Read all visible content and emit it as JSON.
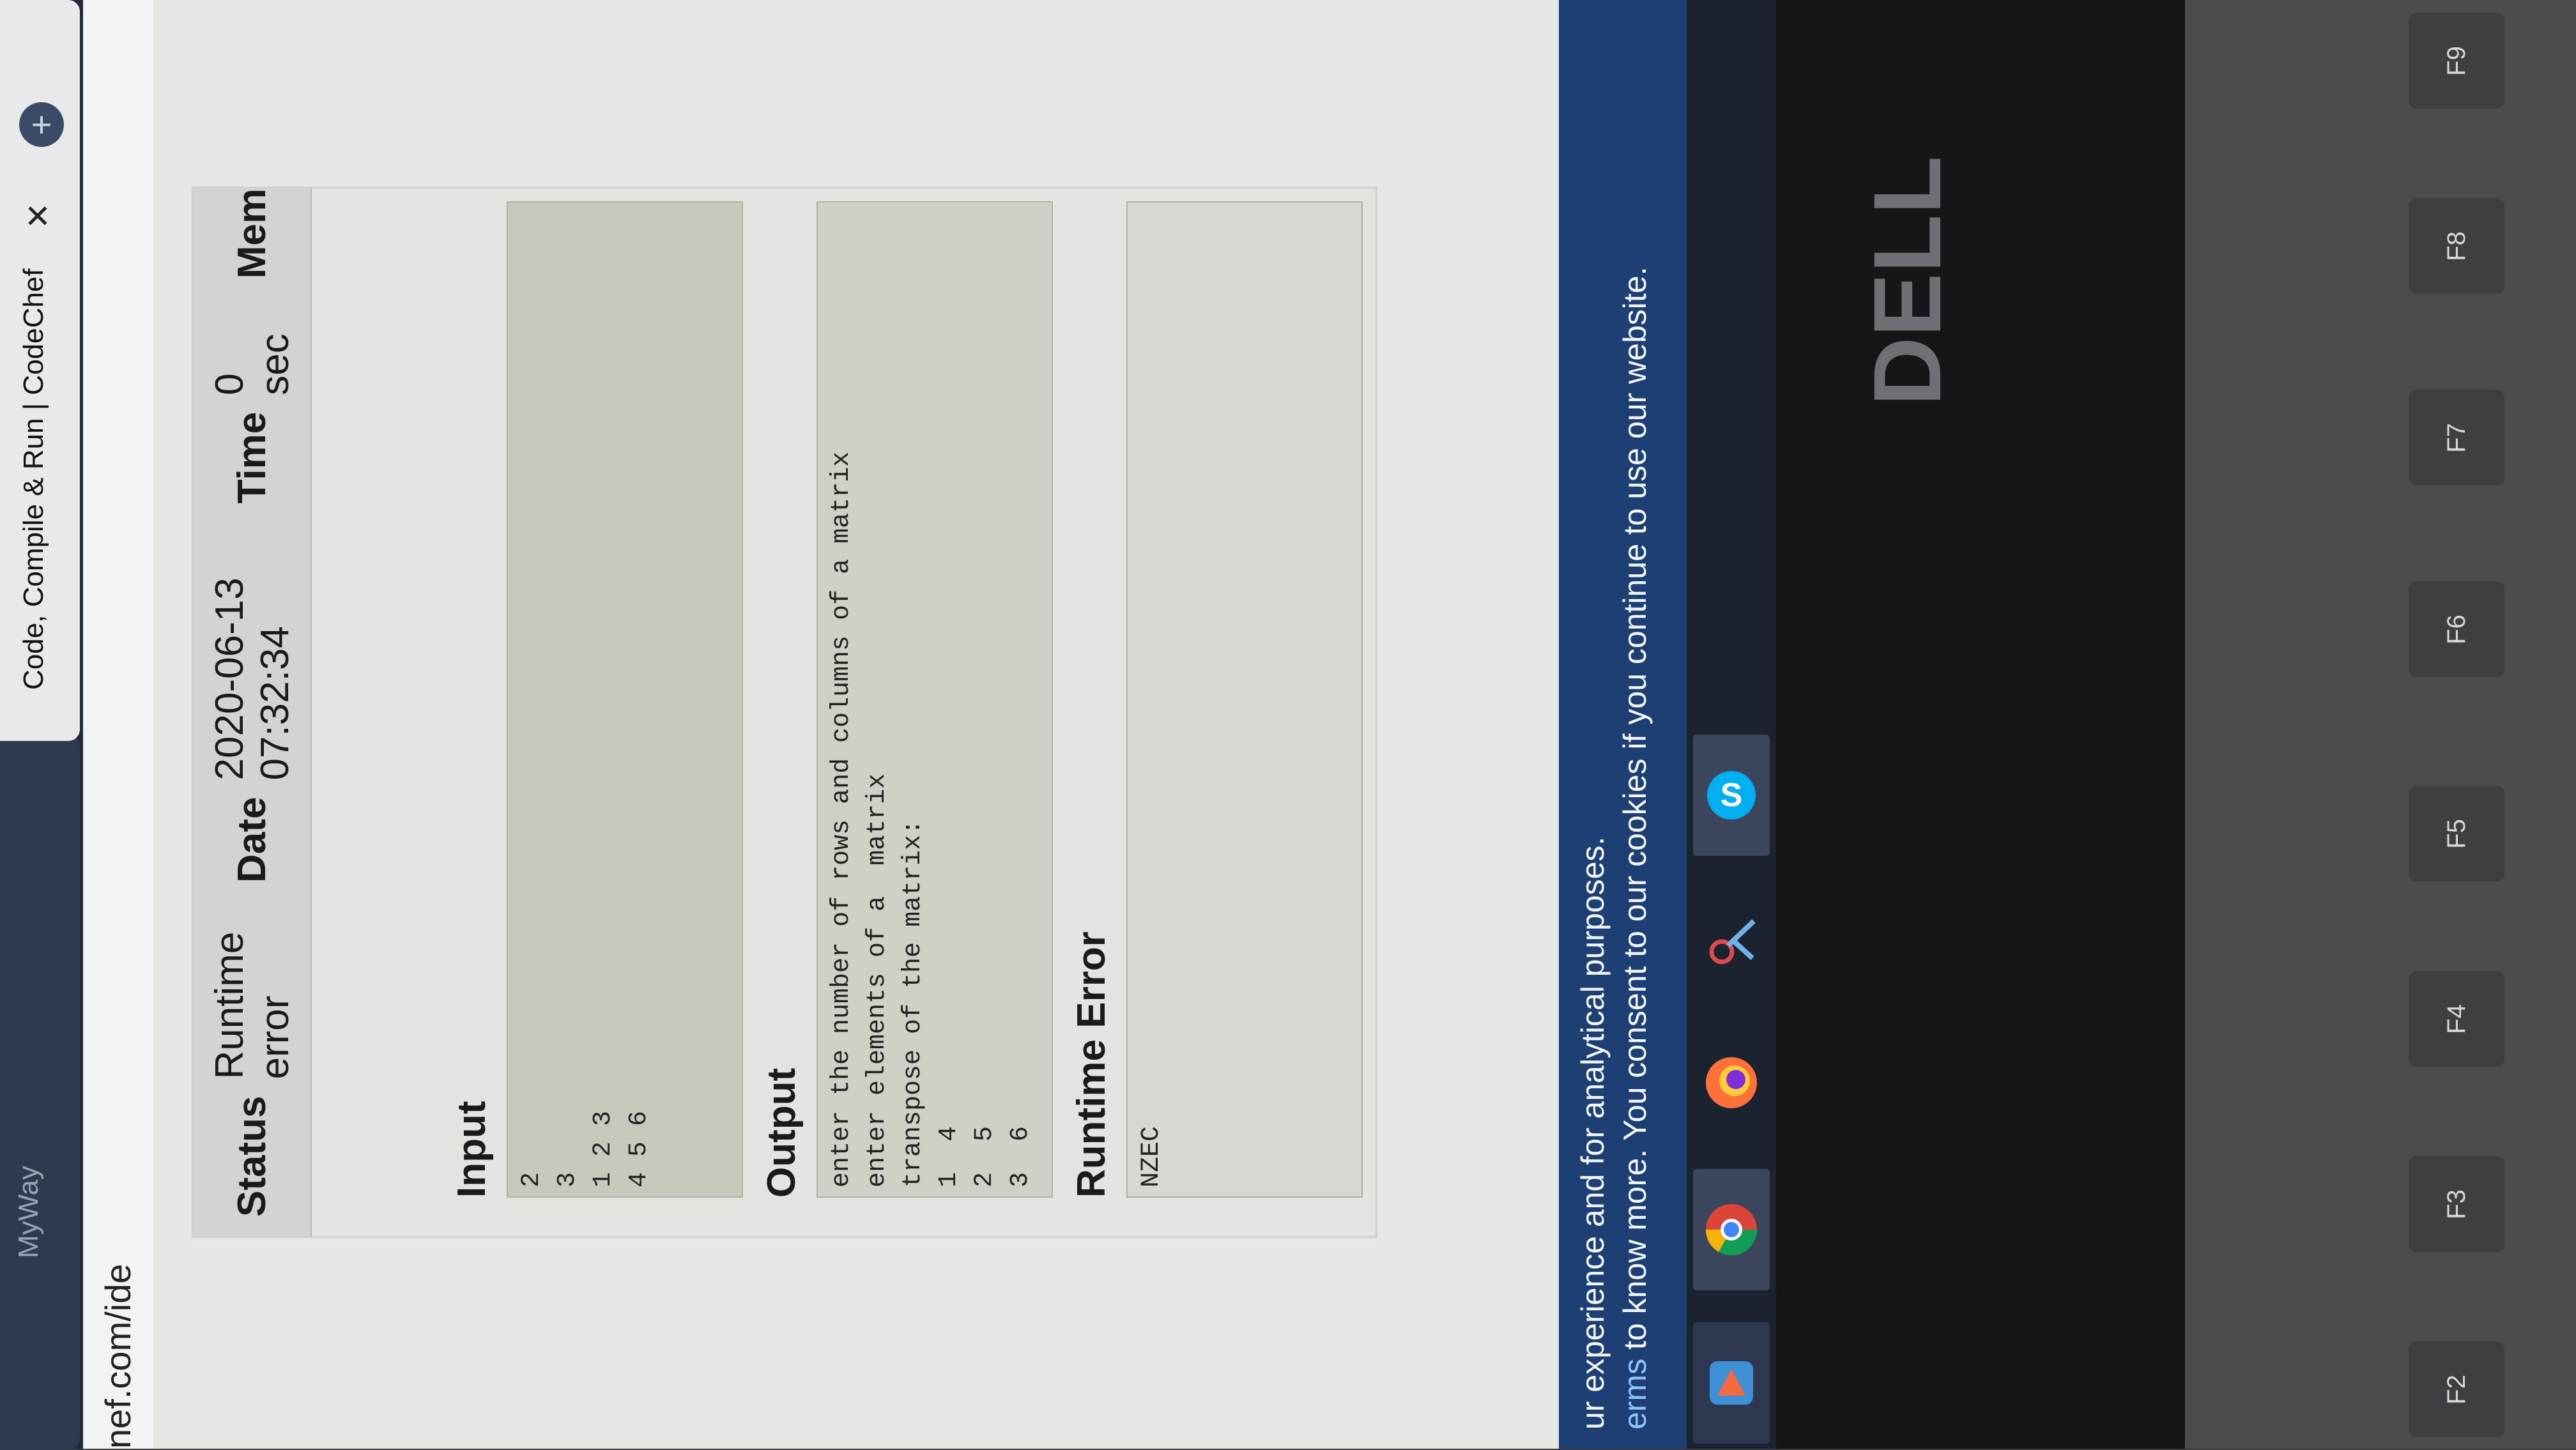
{
  "browser": {
    "active_tab_title": "Code, Compile & Run | CodeChef",
    "inactive_tab_title": "MyWay",
    "close_glyph": "✕",
    "new_tab_glyph": "+",
    "url": "nef.com/ide"
  },
  "status_bar": {
    "status_label": "Status",
    "status_value": "Runtime error",
    "date_label": "Date",
    "date_value": "2020-06-13 07:32:34",
    "time_label": "Time",
    "time_value": "0 sec",
    "mem_label": "Mem"
  },
  "sections": {
    "input_title": "Input",
    "input_text": "2\n3\n1 2 3\n4 5 6",
    "output_title": "Output",
    "output_text": "enter the number of rows and columns of a matrix\nenter elements of a  matrix\ntranspose of the matrix:\n1  4\n2  5\n3  6",
    "error_title": "Runtime Error",
    "error_text": "NZEC"
  },
  "cookie_banner": {
    "line1": "ur experience and for analytical purposes.",
    "line2_link": "erms",
    "line2_text": " to know more. You consent to our cookies if you continue to use our website."
  },
  "taskbar": {
    "icons": [
      "app-icon",
      "chrome-icon",
      "firefox-icon",
      "snipping-tool-icon",
      "skype-icon"
    ]
  },
  "laptop": {
    "brand": "DELL",
    "fkeys": [
      "F2",
      "F3",
      "F4",
      "F5",
      "F6",
      "F7",
      "F8",
      "F9"
    ]
  }
}
